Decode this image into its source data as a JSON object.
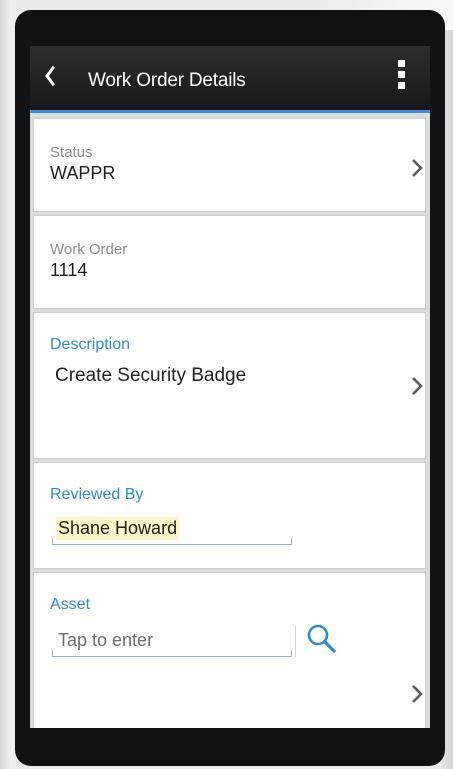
{
  "header": {
    "title": "Work Order Details",
    "back_icon": "chevron-left-icon",
    "menu_icon": "more-vertical-icon"
  },
  "fields": {
    "status": {
      "label": "Status",
      "value": "WAPPR"
    },
    "work_order": {
      "label": "Work Order",
      "value": "1114"
    },
    "description": {
      "label": "Description",
      "value": "Create Security Badge"
    },
    "reviewed_by": {
      "label": "Reviewed By",
      "value": "Shane Howard"
    },
    "asset": {
      "label": "Asset",
      "placeholder": "Tap to enter",
      "search_icon": "search-icon"
    }
  },
  "colors": {
    "accent": "#3b8dd6",
    "label_blue": "#2d8ccc",
    "header_bg": "#1c1c1e",
    "highlight": "#fbf5c8"
  }
}
